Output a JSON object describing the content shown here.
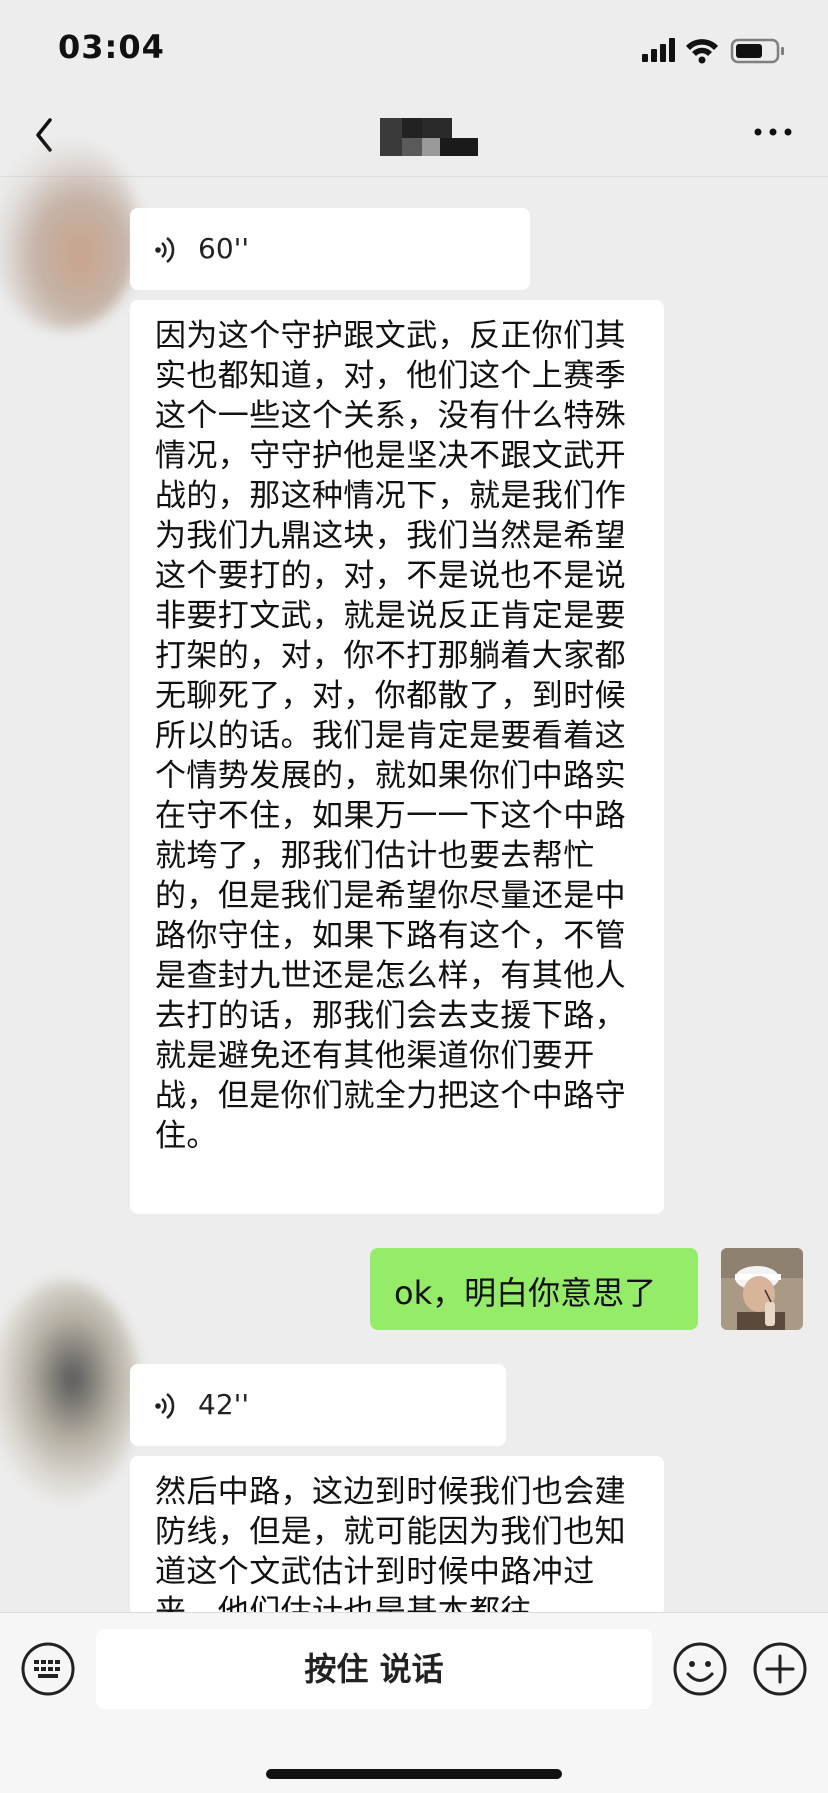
{
  "status_bar": {
    "time": "03:04"
  },
  "nav": {
    "contact_name_pixelated": true
  },
  "messages": [
    {
      "side": "received",
      "type": "voice",
      "duration": "60''"
    },
    {
      "side": "received",
      "type": "transcript",
      "text": "因为这个守护跟文武，反正你们其实也都知道，对，他们这个上赛季这个一些这个关系，没有什么特殊情况，守守护他是坚决不跟文武开战的，那这种情况下，就是我们作为我们九鼎这块，我们当然是希望这个要打的，对，不是说也不是说非要打文武，就是说反正肯定是要打架的，对，你不打那躺着大家都无聊死了，对，你都散了，到时候所以的话。我们是肯定是要看着这个情势发展的，就如果你们中路实在守不住，如果万一一下这个中路就垮了，那我们估计也要去帮忙的，但是我们是希望你尽量还是中路你守住，如果下路有这个，不管是查封九世还是怎么样，有其他人去打的话，那我们会去支援下路，就是避免还有其他渠道你们要开战，但是你们就全力把这个中路守住。"
    },
    {
      "side": "sent",
      "type": "text",
      "text": "ok，明白你意思了"
    },
    {
      "side": "received",
      "type": "voice",
      "duration": "42''"
    },
    {
      "side": "received",
      "type": "transcript",
      "text": "然后中路，这边到时候我们也会建防线，但是，就可能因为我们也知道这个文武估计到时候中路冲过来，他们估计也是基本都往"
    }
  ],
  "input_bar": {
    "hold_to_talk_label": "按住 说话"
  },
  "colors": {
    "background": "#ededed",
    "sent_bubble": "#95ec69",
    "received_bubble": "#ffffff"
  }
}
